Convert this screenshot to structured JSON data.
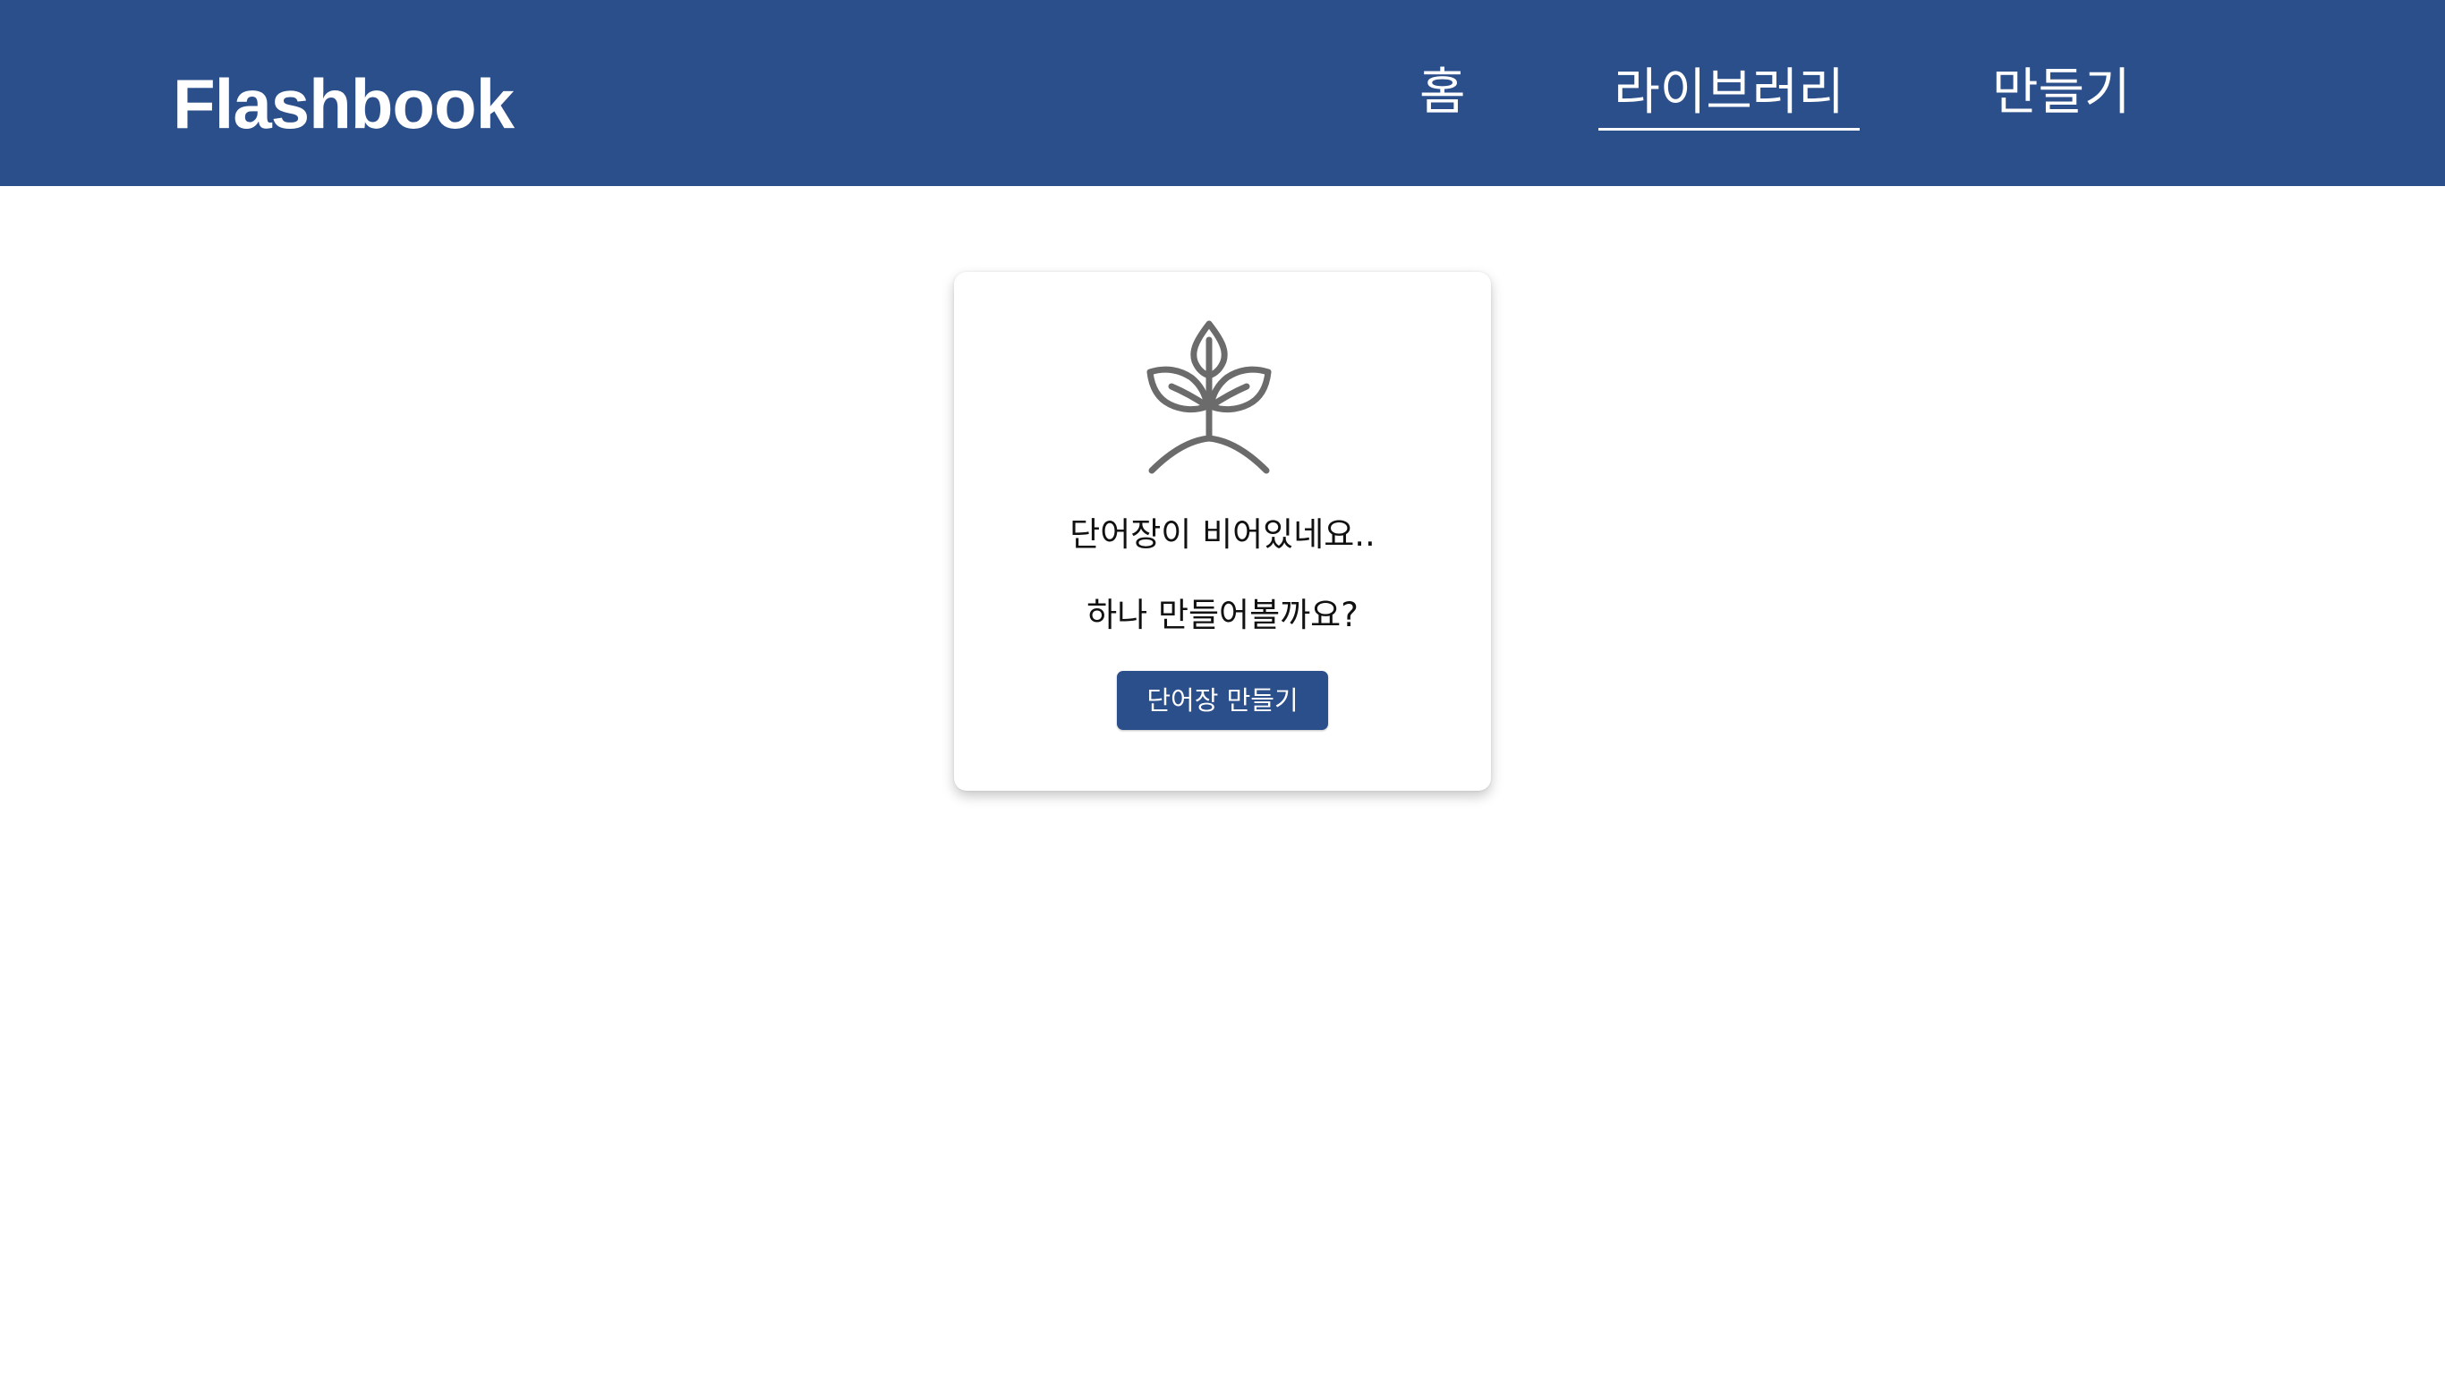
{
  "header": {
    "logo": "Flashbook",
    "nav": [
      {
        "label": "홈",
        "active": false
      },
      {
        "label": "라이브러리",
        "active": true
      },
      {
        "label": "만들기",
        "active": false
      }
    ]
  },
  "empty_state": {
    "icon": "sprout-icon",
    "line1": "단어장이 비어있네요..",
    "line2": "하나 만들어볼까요?",
    "button_label": "단어장 만들기"
  },
  "colors": {
    "brand": "#2b4f8b",
    "icon": "#6b6b6b"
  }
}
